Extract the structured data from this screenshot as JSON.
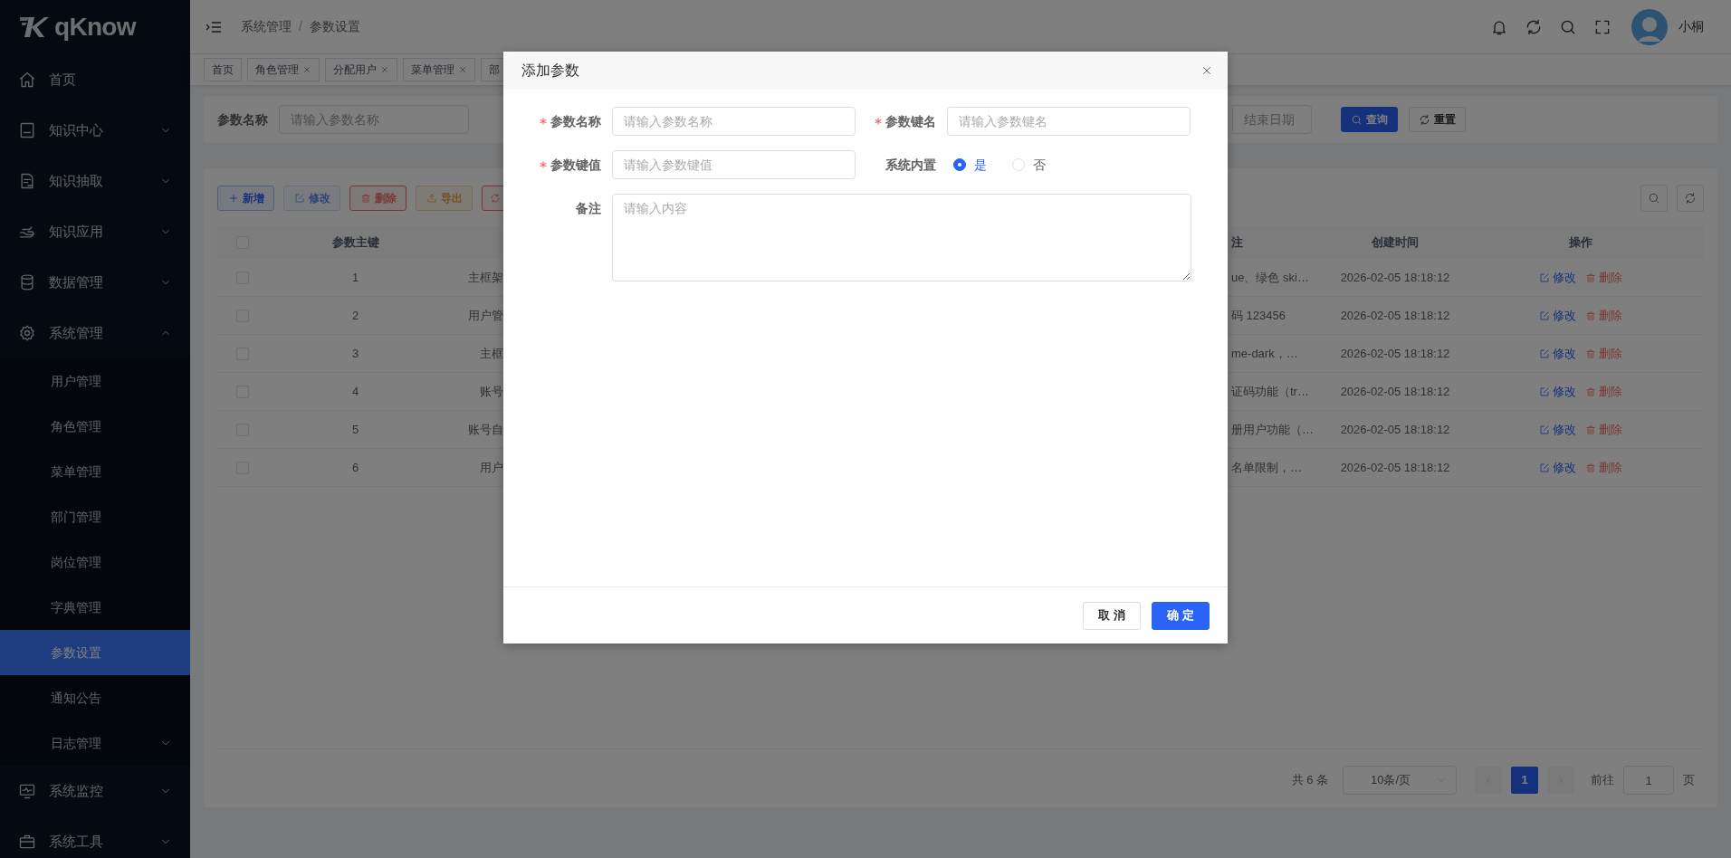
{
  "sidebar": {
    "logo": "qKnow",
    "items": [
      {
        "label": "首页",
        "kind": "link",
        "selected": false
      },
      {
        "label": "知识中心",
        "kind": "group",
        "expanded": false,
        "selected": false
      },
      {
        "label": "知识抽取",
        "kind": "group",
        "expanded": false,
        "selected": false
      },
      {
        "label": "知识应用",
        "kind": "group",
        "expanded": false,
        "selected": false
      },
      {
        "label": "数据管理",
        "kind": "group",
        "expanded": false,
        "selected": false
      },
      {
        "label": "系统管理",
        "kind": "group",
        "expanded": true,
        "selected": false,
        "children": [
          {
            "label": "用户管理",
            "kind": "link",
            "selected": false
          },
          {
            "label": "角色管理",
            "kind": "link",
            "selected": false
          },
          {
            "label": "菜单管理",
            "kind": "link",
            "selected": false
          },
          {
            "label": "部门管理",
            "kind": "link",
            "selected": false
          },
          {
            "label": "岗位管理",
            "kind": "link",
            "selected": false
          },
          {
            "label": "字典管理",
            "kind": "link",
            "selected": false
          },
          {
            "label": "参数设置",
            "kind": "link",
            "selected": true
          },
          {
            "label": "通知公告",
            "kind": "link",
            "selected": false
          },
          {
            "label": "日志管理",
            "kind": "group",
            "expanded": false,
            "selected": false
          }
        ]
      },
      {
        "label": "系统监控",
        "kind": "group",
        "expanded": false,
        "selected": false
      },
      {
        "label": "系统工具",
        "kind": "group",
        "expanded": false,
        "selected": false
      }
    ]
  },
  "header": {
    "breadcrumb": [
      "系统管理",
      "参数设置"
    ],
    "separator": "/",
    "user_name": "小桐"
  },
  "tabs": [
    {
      "label": "首页",
      "closable": false
    },
    {
      "label": "角色管理",
      "closable": true
    },
    {
      "label": "分配用户",
      "closable": true
    },
    {
      "label": "菜单管理",
      "closable": true
    },
    {
      "label": "部",
      "closable": false
    }
  ],
  "search": {
    "name_label": "参数名称",
    "name_placeholder": "请输入参数名称",
    "end_date_placeholder": "结束日期",
    "buttons": [
      {
        "label": "查询",
        "kind": "primary"
      },
      {
        "label": "重置",
        "kind": "default"
      }
    ]
  },
  "toolbar": [
    {
      "label": "新增",
      "kind": "primary",
      "disabled": false
    },
    {
      "label": "修改",
      "kind": "primary",
      "disabled": true
    },
    {
      "label": "删除",
      "kind": "danger",
      "disabled": false
    },
    {
      "label": "导出",
      "kind": "warning",
      "disabled": false
    },
    {
      "kind": "danger",
      "disabled": false
    }
  ],
  "table": {
    "header_checked": false,
    "columns": {
      "column_2": "参数主键",
      "remark": "注",
      "created": "创建时间",
      "actions": "操作"
    },
    "rows": [
      {
        "checked": false,
        "id": "1",
        "column_3": "主框架",
        "remark": "ue、绿色 ski…",
        "created": "2026-02-05 18:18:12",
        "edit": "修改",
        "delete": "删除"
      },
      {
        "checked": false,
        "id": "2",
        "column_3": "用户管",
        "remark": "码 123456",
        "created": "2026-02-05 18:18:12",
        "edit": "修改",
        "delete": "删除"
      },
      {
        "checked": false,
        "id": "3",
        "column_3": "主框",
        "remark": "me-dark，…",
        "created": "2026-02-05 18:18:12",
        "edit": "修改",
        "delete": "删除"
      },
      {
        "checked": false,
        "id": "4",
        "column_3": "账号",
        "remark": "证码功能（tr…",
        "created": "2026-02-05 18:18:12",
        "edit": "修改",
        "delete": "删除"
      },
      {
        "checked": false,
        "id": "5",
        "column_3": "账号自",
        "remark": "册用户功能（…",
        "created": "2026-02-05 18:18:12",
        "edit": "修改",
        "delete": "删除"
      },
      {
        "checked": false,
        "id": "6",
        "column_3": "用户",
        "remark": "名单限制，…",
        "created": "2026-02-05 18:18:12",
        "edit": "修改",
        "delete": "删除"
      }
    ]
  },
  "pagination": {
    "total": "共 6 条",
    "page_size": "10条/页",
    "pages": [
      {
        "label": "1",
        "selected": true
      }
    ],
    "goto_label": "前往",
    "goto_value": "1",
    "goto_suffix": "页"
  },
  "dialog": {
    "title": "添加参数",
    "fields": [
      {
        "kind": "input",
        "label": "参数名称",
        "required": true,
        "placeholder": "请输入参数名称"
      },
      {
        "kind": "input",
        "label": "参数键名",
        "required": true,
        "placeholder": "请输入参数键名"
      },
      {
        "kind": "input",
        "label": "参数键值",
        "required": true,
        "placeholder": "请输入参数键值"
      },
      {
        "kind": "radio",
        "label": "系统内置",
        "required": false,
        "options": [
          {
            "label": "是",
            "selected": true
          },
          {
            "label": "否",
            "selected": false
          }
        ]
      },
      {
        "kind": "textarea",
        "label": "备注",
        "required": false,
        "placeholder": "请输入内容"
      }
    ],
    "buttons": [
      {
        "label": "取 消",
        "kind": "default"
      },
      {
        "label": "确 定",
        "kind": "primary"
      }
    ]
  }
}
